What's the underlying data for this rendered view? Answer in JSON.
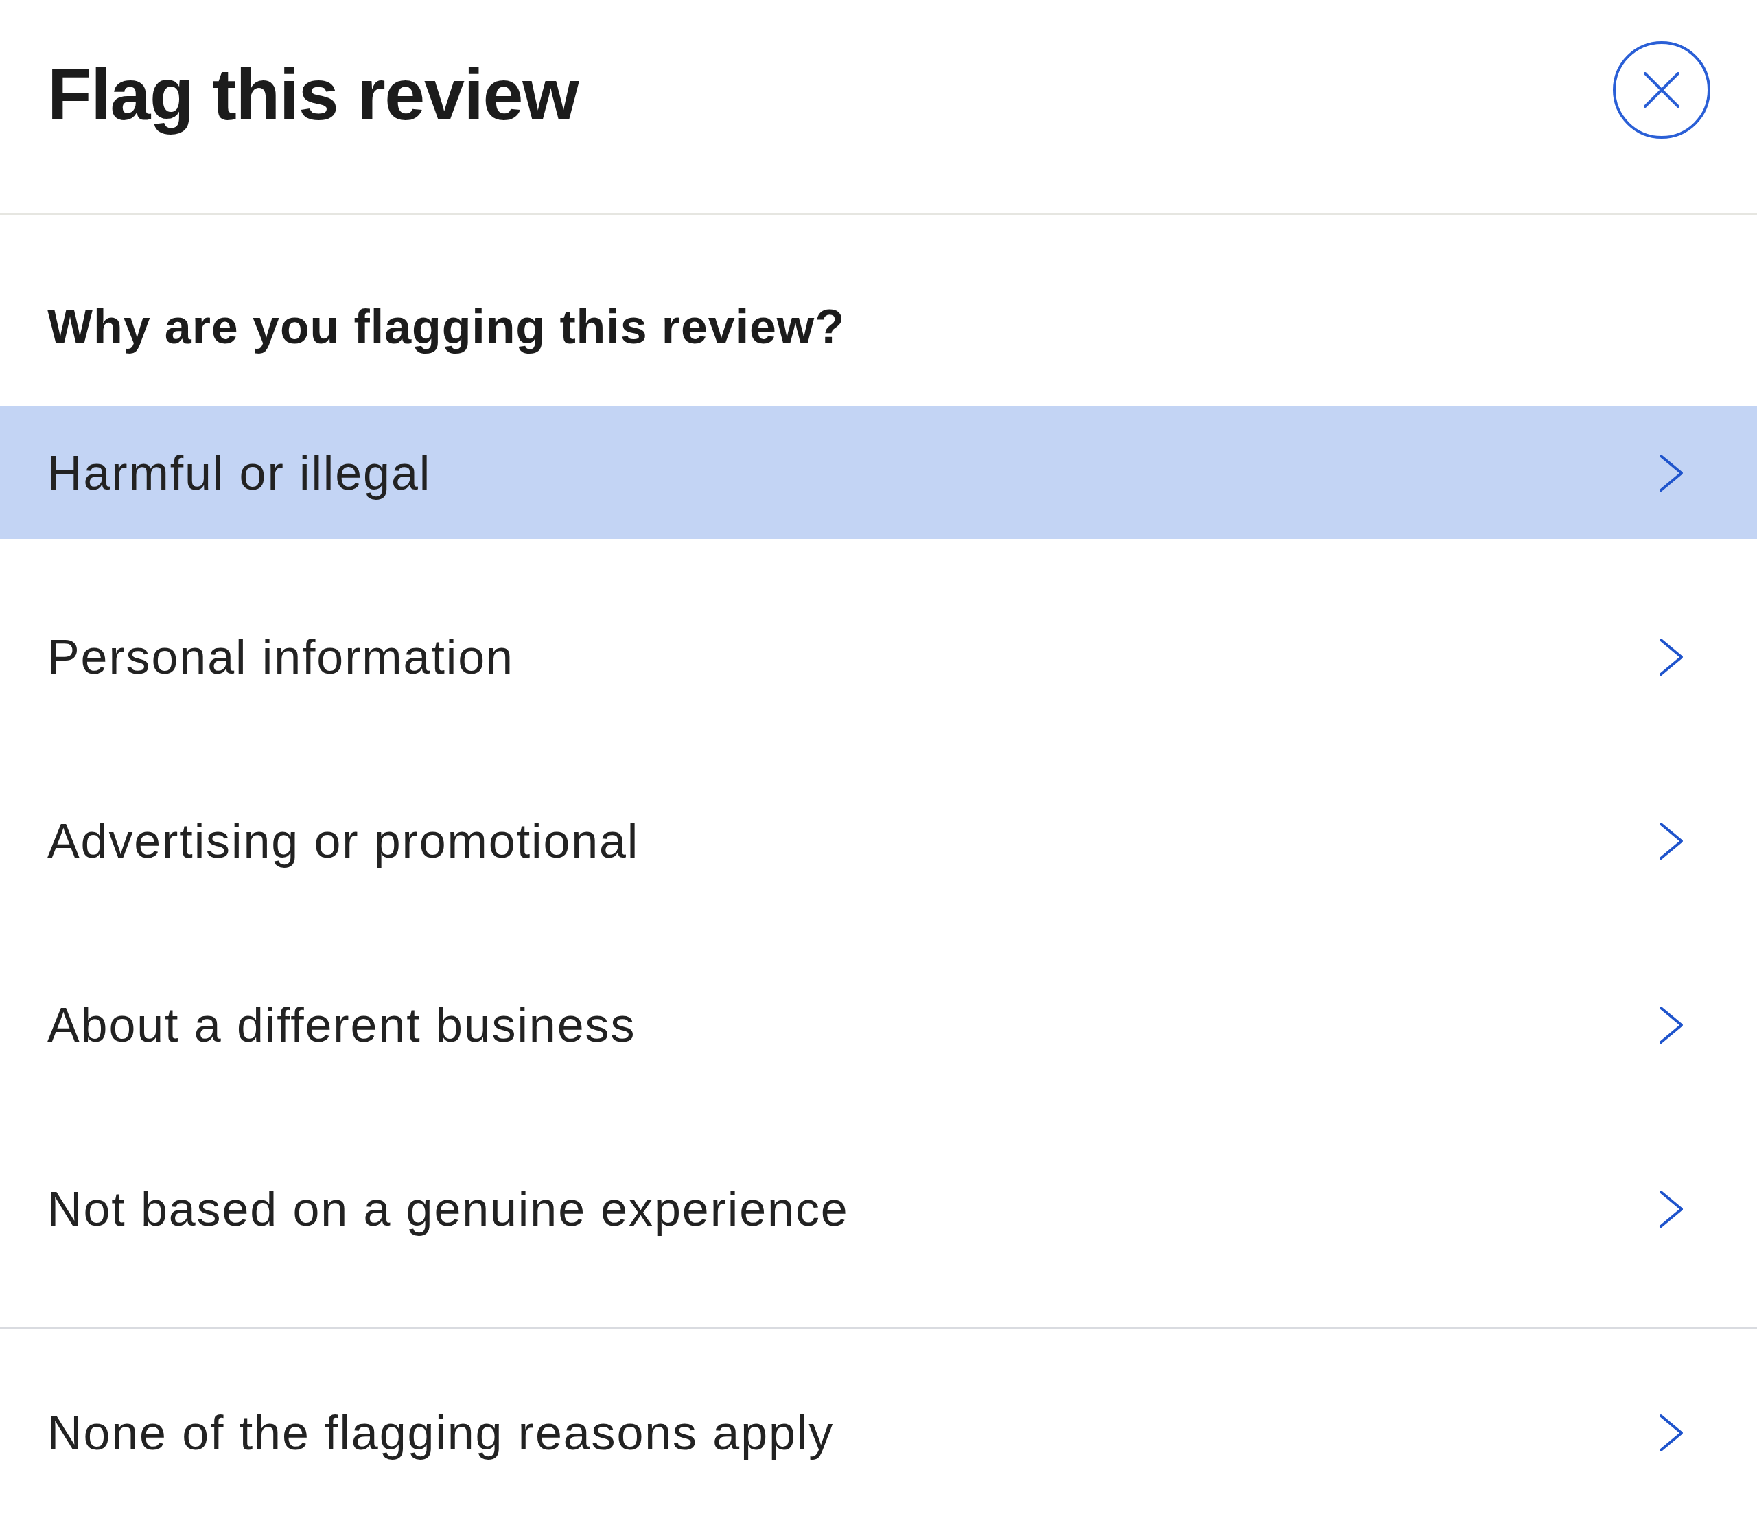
{
  "header": {
    "title": "Flag this review"
  },
  "question": "Why are you flagging this review?",
  "reasons": [
    {
      "label": "Harmful or illegal",
      "selected": true
    },
    {
      "label": "Personal information",
      "selected": false
    },
    {
      "label": "Advertising or promotional",
      "selected": false
    },
    {
      "label": "About a different business",
      "selected": false
    },
    {
      "label": "Not based on a genuine experience",
      "selected": false
    }
  ],
  "other_reasons": [
    {
      "label": "None of the flagging reasons apply",
      "selected": false
    }
  ]
}
